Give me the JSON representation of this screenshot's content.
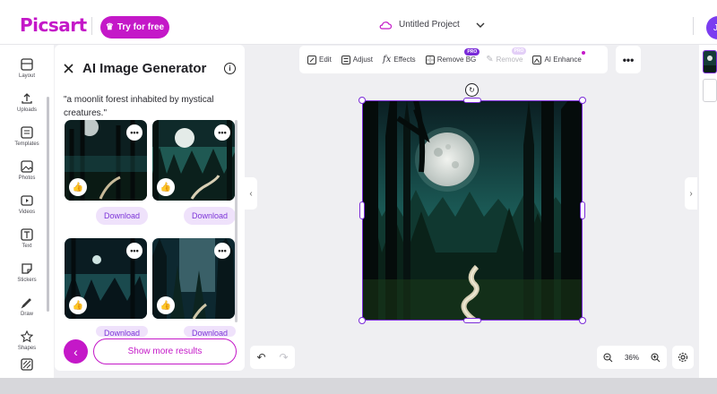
{
  "header": {
    "logo": "Picsart",
    "try_label": "Try for free",
    "project_title": "Untitled Project",
    "avatar_initial": "J"
  },
  "nav": [
    {
      "label": "Layout",
      "icon": "layout-icon"
    },
    {
      "label": "Uploads",
      "icon": "upload-icon"
    },
    {
      "label": "Templates",
      "icon": "templates-icon"
    },
    {
      "label": "Photos",
      "icon": "photos-icon"
    },
    {
      "label": "Videos",
      "icon": "videos-icon"
    },
    {
      "label": "Text",
      "icon": "text-icon"
    },
    {
      "label": "Stickers",
      "icon": "stickers-icon"
    },
    {
      "label": "Draw",
      "icon": "draw-icon"
    },
    {
      "label": "Shapes",
      "icon": "shapes-icon"
    }
  ],
  "panel": {
    "title": "AI Image Generator",
    "prompt": "\"a moonlit forest inhabited by mystical creatures.\"",
    "download_label": "Download",
    "show_more": "Show more results"
  },
  "toolbar": {
    "edit": "Edit",
    "adjust": "Adjust",
    "effects": "Effects",
    "remove_bg": "Remove BG",
    "remove": "Remove",
    "ai_enhance": "AI Enhance",
    "pro_badge": "PRO"
  },
  "zoom": {
    "level": "36%"
  },
  "colors": {
    "brand": "#c418c8",
    "selection": "#7a2bd8",
    "forest_teal": "#2a7a70"
  }
}
